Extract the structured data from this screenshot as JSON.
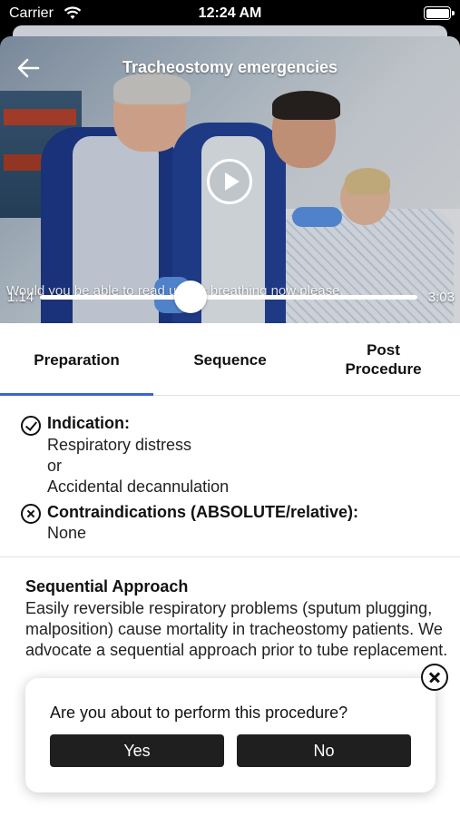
{
  "status_bar": {
    "carrier": "Carrier",
    "time": "12:24 AM",
    "icons": [
      "wifi-icon",
      "battery-icon"
    ]
  },
  "video": {
    "title": "Tracheostomy emergencies",
    "caption": "Would you be able to read us her breathing now please.",
    "current_time": "1:14",
    "total_time": "3:03",
    "progress": 0.4,
    "icons": [
      "back-arrow-icon",
      "play-icon"
    ]
  },
  "tabs": [
    {
      "label": "Preparation",
      "active": true
    },
    {
      "label": "Sequence",
      "active": false
    },
    {
      "label": "Post\nProcedure",
      "active": false
    }
  ],
  "indication": {
    "title": "Indication:",
    "lines": [
      "Respiratory distress",
      "or",
      "Accidental decannulation"
    ],
    "icon": "check-circle-icon"
  },
  "contraindications": {
    "title": "Contraindications (ABSOLUTE/relative):",
    "value": "None",
    "icon": "x-circle-icon"
  },
  "sequential": {
    "title": "Sequential Approach",
    "body": "Easily reversible respiratory problems (sputum plugging, malposition) cause mortality in tracheostomy patients. We advocate a sequential approach prior to tube replacement."
  },
  "modal": {
    "question": "Are you about to perform this procedure?",
    "yes_label": "Yes",
    "no_label": "No",
    "close_icon": "close-circle-icon"
  },
  "colors": {
    "accent": "#3a63d8",
    "button_dark": "#1f1f1f"
  }
}
